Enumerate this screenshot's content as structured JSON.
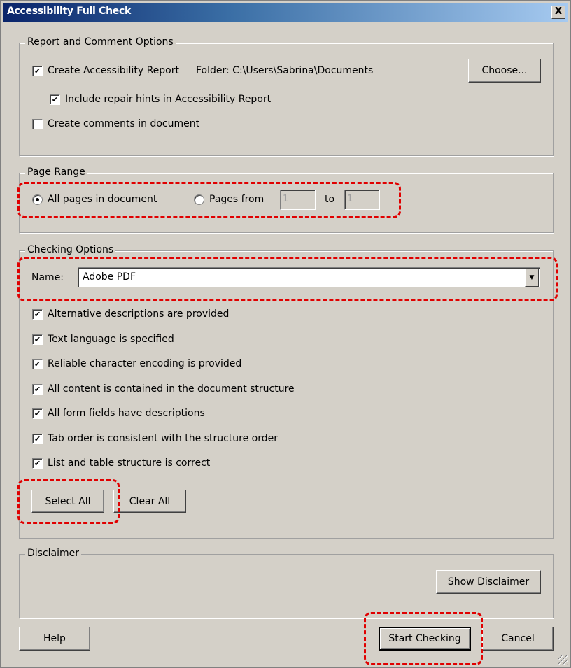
{
  "window": {
    "title": "Accessibility Full Check",
    "close_label": "X"
  },
  "report_options": {
    "legend": "Report and Comment Options",
    "create_report": {
      "label": "Create Accessibility Report",
      "checked": true
    },
    "folder_label": "Folder: C:\\Users\\Sabrina\\Documents",
    "choose_button": "Choose...",
    "include_hints": {
      "label": "Include repair hints in Accessibility Report",
      "checked": true
    },
    "create_comments": {
      "label": "Create comments in document",
      "checked": false
    }
  },
  "page_range": {
    "legend": "Page Range",
    "all_pages_label": "All pages in document",
    "pages_from_label": "Pages from",
    "selected": "all",
    "from_value": "1",
    "to_label": "to",
    "to_value": "1"
  },
  "checking_options": {
    "legend": "Checking Options",
    "name_label": "Name:",
    "name_value": "Adobe PDF",
    "options": [
      {
        "label": "Alternative descriptions are provided",
        "checked": true
      },
      {
        "label": "Text language is specified",
        "checked": true
      },
      {
        "label": "Reliable character encoding is provided",
        "checked": true
      },
      {
        "label": "All content is contained in the document structure",
        "checked": true
      },
      {
        "label": "All form fields have descriptions",
        "checked": true
      },
      {
        "label": "Tab order is consistent with the structure order",
        "checked": true
      },
      {
        "label": "List and table structure is correct",
        "checked": true
      }
    ],
    "select_all": "Select All",
    "clear_all": "Clear All"
  },
  "disclaimer": {
    "legend": "Disclaimer",
    "show_button": "Show Disclaimer"
  },
  "footer": {
    "help": "Help",
    "start": "Start Checking",
    "cancel": "Cancel"
  },
  "colors": {
    "highlight": "#e00000",
    "title_start": "#0a246a",
    "title_end": "#a6caf0"
  }
}
